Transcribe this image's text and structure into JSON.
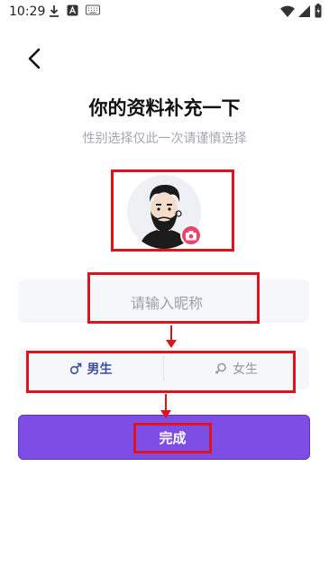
{
  "status_bar": {
    "time": "10:29",
    "icons": [
      "download-icon",
      "font-app-icon",
      "keyboard-icon",
      "wifi-icon",
      "signal-icon",
      "battery-icon"
    ]
  },
  "header": {
    "title": "你的资料补充一下",
    "subtitle": "性别选择仅此一次请谨慎选择"
  },
  "nickname": {
    "placeholder": "请输入昵称",
    "value": ""
  },
  "gender": {
    "male_label": "男生",
    "female_label": "女生",
    "selected": "male"
  },
  "submit_label": "完成",
  "colors": {
    "accent": "#7d4de6",
    "annotation": "#e0121b",
    "male_text": "#3b4ea0",
    "camera_badge": "#e6466c"
  }
}
